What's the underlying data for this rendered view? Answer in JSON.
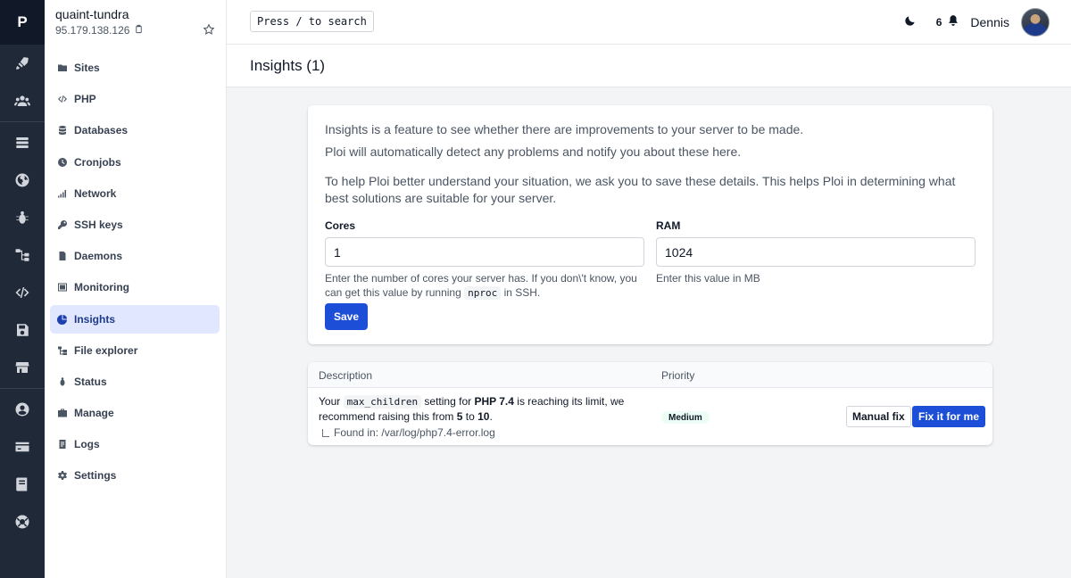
{
  "rail": {
    "logo": "P",
    "items": [
      {
        "icon": "rocket-icon"
      },
      {
        "icon": "users-icon"
      },
      {
        "icon": "server-list-icon"
      },
      {
        "icon": "globe-icon"
      },
      {
        "icon": "bug-icon"
      },
      {
        "icon": "flow-icon"
      },
      {
        "icon": "code-icon"
      },
      {
        "icon": "save-icon"
      },
      {
        "icon": "store-icon"
      },
      {
        "icon": "user-circle-icon"
      },
      {
        "icon": "credit-card-icon"
      },
      {
        "icon": "book-icon"
      },
      {
        "icon": "support-icon"
      }
    ]
  },
  "server": {
    "name": "quaint-tundra",
    "ip": "95.179.138.126"
  },
  "sidebar": {
    "items": [
      {
        "label": "Sites",
        "icon": "folder-icon"
      },
      {
        "label": "PHP",
        "icon": "code-icon"
      },
      {
        "label": "Databases",
        "icon": "database-icon"
      },
      {
        "label": "Cronjobs",
        "icon": "clock-icon"
      },
      {
        "label": "Network",
        "icon": "signal-icon"
      },
      {
        "label": "SSH keys",
        "icon": "key-icon"
      },
      {
        "label": "Daemons",
        "icon": "document-icon"
      },
      {
        "label": "Monitoring",
        "icon": "monitor-icon"
      },
      {
        "label": "Insights",
        "icon": "chart-pie-icon",
        "active": true
      },
      {
        "label": "File explorer",
        "icon": "folder-tree-icon"
      },
      {
        "label": "Status",
        "icon": "status-icon"
      },
      {
        "label": "Manage",
        "icon": "briefcase-icon"
      },
      {
        "label": "Logs",
        "icon": "logs-icon"
      },
      {
        "label": "Settings",
        "icon": "gear-icon"
      }
    ]
  },
  "topbar": {
    "search_label": "Press / to search",
    "notification_count": "6",
    "user_name": "Dennis"
  },
  "page": {
    "title": "Insights (1)"
  },
  "intro": {
    "line1": "Insights is a feature to see whether there are improvements to your server to be made.",
    "line2": "Ploi will automatically detect any problems and notify you about these here.",
    "line3": "To help Ploi better understand your situation, we ask you to save these details. This helps Ploi in determining what best solutions are suitable for your server."
  },
  "form": {
    "cores": {
      "label": "Cores",
      "value": "1",
      "help_before": "Enter the number of cores your server has. If you don\\'t know, you can get this value by running",
      "help_code": "nproc",
      "help_after": "in SSH."
    },
    "ram": {
      "label": "RAM",
      "value": "1024",
      "help": "Enter this value in MB"
    },
    "save_label": "Save"
  },
  "table": {
    "headers": {
      "description": "Description",
      "priority": "Priority"
    },
    "rows": [
      {
        "desc_prefix": "Your",
        "desc_code": "max_children",
        "desc_mid": "setting for",
        "desc_version": "PHP 7.4",
        "desc_mid2": "is reaching its limit, we recommend raising this from",
        "desc_from": "5",
        "desc_to_word": "to",
        "desc_to": "10",
        "desc_end": ".",
        "found": "Found in: /var/log/php7.4-error.log",
        "priority": "Medium",
        "manual_label": "Manual fix",
        "fix_label": "Fix it for me"
      }
    ]
  }
}
